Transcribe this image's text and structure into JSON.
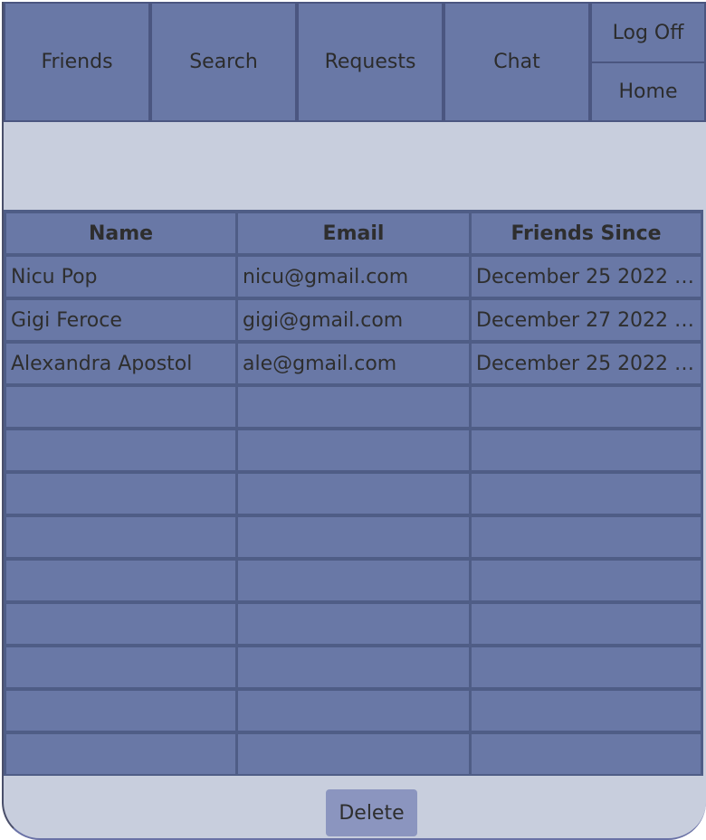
{
  "nav": {
    "friends": "Friends",
    "search": "Search",
    "requests": "Requests",
    "chat": "Chat",
    "log_off": "Log Off",
    "home": "Home"
  },
  "table": {
    "headers": [
      "Name",
      "Email",
      "Friends Since"
    ],
    "rows": [
      [
        "Nicu Pop",
        "nicu@gmail.com",
        "December 25 2022 0..."
      ],
      [
        "Gigi Feroce",
        "gigi@gmail.com",
        "December 27 2022 1..."
      ],
      [
        "Alexandra Apostol",
        "ale@gmail.com",
        "December 25 2022 0..."
      ],
      [
        "",
        "",
        ""
      ],
      [
        "",
        "",
        ""
      ],
      [
        "",
        "",
        ""
      ],
      [
        "",
        "",
        ""
      ],
      [
        "",
        "",
        ""
      ],
      [
        "",
        "",
        ""
      ],
      [
        "",
        "",
        ""
      ],
      [
        "",
        "",
        ""
      ],
      [
        "",
        "",
        ""
      ]
    ]
  },
  "actions": {
    "delete": "Delete"
  },
  "colors": {
    "panel": "#c8cedd",
    "button": "#6978a6",
    "grid": "#4f5d86",
    "delete_button": "#8b95bf"
  }
}
